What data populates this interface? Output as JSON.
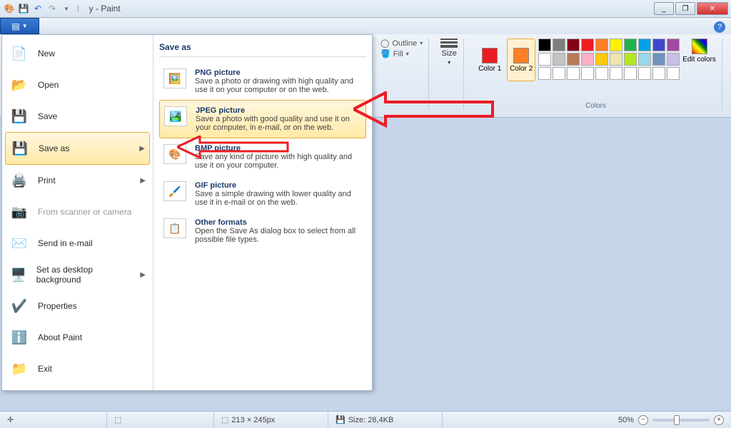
{
  "titlebar": {
    "title": "y - Paint"
  },
  "window_controls": {
    "minimize": "_",
    "maximize": "❐",
    "close": "✕"
  },
  "ribbon": {
    "outline_label": "Outline",
    "fill_label": "Fill",
    "size_label": "Size",
    "color1_label": "Color 1",
    "color2_label": "Color 2",
    "edit_colors_label": "Edit colors",
    "colors_group": "Colors",
    "color1_value": "#ed1c24",
    "color2_value": "#ff7f27",
    "palette_row1": [
      "#000000",
      "#7f7f7f",
      "#880015",
      "#ed1c24",
      "#ff7f27",
      "#fff200",
      "#22b14c",
      "#00a2e8",
      "#3f48cc",
      "#a349a4"
    ],
    "palette_row2": [
      "#ffffff",
      "#c3c3c3",
      "#b97a57",
      "#ffaec9",
      "#ffc90e",
      "#efe4b0",
      "#b5e61d",
      "#99d9ea",
      "#7092be",
      "#c8bfe7"
    ],
    "palette_row3": [
      "#ffffff",
      "#ffffff",
      "#ffffff",
      "#ffffff",
      "#ffffff",
      "#ffffff",
      "#ffffff",
      "#ffffff",
      "#ffffff",
      "#ffffff"
    ]
  },
  "menu": {
    "items": [
      {
        "label": "New",
        "icon": "doc",
        "arrow": false
      },
      {
        "label": "Open",
        "icon": "folder",
        "arrow": false
      },
      {
        "label": "Save",
        "icon": "floppy",
        "arrow": false
      },
      {
        "label": "Save as",
        "icon": "floppy-as",
        "arrow": true,
        "highlight": true
      },
      {
        "label": "Print",
        "icon": "printer",
        "arrow": true
      },
      {
        "label": "From scanner or camera",
        "icon": "scanner",
        "arrow": false,
        "disabled": true
      },
      {
        "label": "Send in e-mail",
        "icon": "mail",
        "arrow": false
      },
      {
        "label": "Set as desktop background",
        "icon": "desktop",
        "arrow": true
      },
      {
        "label": "Properties",
        "icon": "check",
        "arrow": false
      },
      {
        "label": "About Paint",
        "icon": "info",
        "arrow": false
      },
      {
        "label": "Exit",
        "icon": "exit",
        "arrow": false
      }
    ],
    "saveas_title": "Save as",
    "formats": [
      {
        "title": "PNG picture",
        "desc": "Save a photo or drawing with high quality and use it on your computer or on the web.",
        "icon": "png"
      },
      {
        "title": "JPEG picture",
        "desc": "Save a photo with good quality and use it on your computer, in e-mail, or on the web.",
        "icon": "jpeg",
        "highlight": true
      },
      {
        "title": "BMP picture",
        "desc": "Save any kind of picture with high quality and use it on your computer.",
        "icon": "bmp"
      },
      {
        "title": "GIF picture",
        "desc": "Save a simple drawing with lower quality and use it in e-mail or on the web.",
        "icon": "gif"
      },
      {
        "title": "Other formats",
        "desc": "Open the Save As dialog box to select from all possible file types.",
        "icon": "other"
      }
    ]
  },
  "statusbar": {
    "dimensions": "213 × 245px",
    "size_label": "Size: 28,4KB",
    "zoom": "50%"
  }
}
